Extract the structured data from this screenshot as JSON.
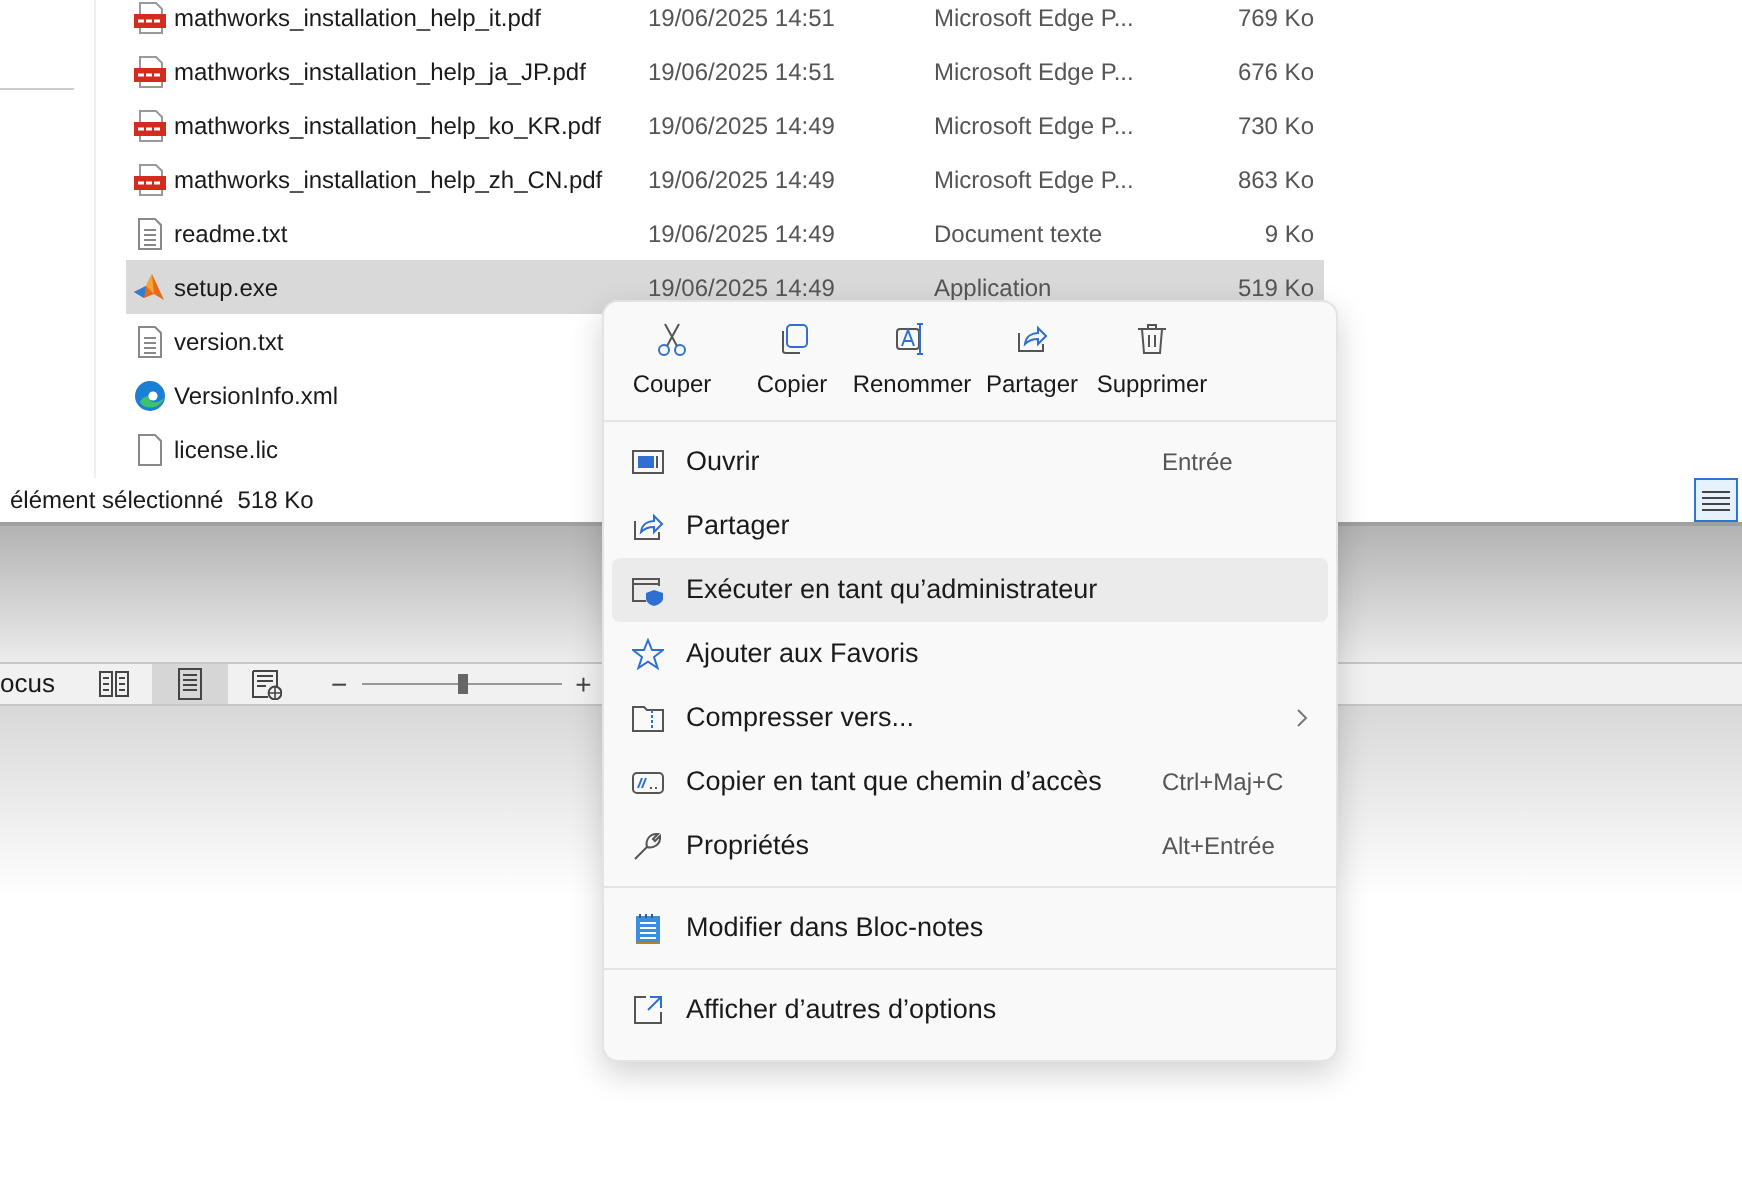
{
  "explorer": {
    "files": [
      {
        "name": "mathworks_installation_help_it.pdf",
        "kind": "pdf",
        "date": "19/06/2025 14:51",
        "type": "Microsoft Edge P...",
        "size": "769 Ko",
        "selected": false
      },
      {
        "name": "mathworks_installation_help_ja_JP.pdf",
        "kind": "pdf",
        "date": "19/06/2025 14:51",
        "type": "Microsoft Edge P...",
        "size": "676 Ko",
        "selected": false
      },
      {
        "name": "mathworks_installation_help_ko_KR.pdf",
        "kind": "pdf",
        "date": "19/06/2025 14:49",
        "type": "Microsoft Edge P...",
        "size": "730 Ko",
        "selected": false
      },
      {
        "name": "mathworks_installation_help_zh_CN.pdf",
        "kind": "pdf",
        "date": "19/06/2025 14:49",
        "type": "Microsoft Edge P...",
        "size": "863 Ko",
        "selected": false
      },
      {
        "name": "readme.txt",
        "kind": "text",
        "date": "19/06/2025 14:49",
        "type": "Document texte",
        "size": "9 Ko",
        "selected": false
      },
      {
        "name": "setup.exe",
        "kind": "app",
        "date": "19/06/2025 14:49",
        "type": "Application",
        "size": "519 Ko",
        "selected": true
      },
      {
        "name": "version.txt",
        "kind": "text",
        "selected": false
      },
      {
        "name": "VersionInfo.xml",
        "kind": "web",
        "selected": false
      },
      {
        "name": "license.lic",
        "kind": "file",
        "selected": false
      }
    ],
    "status_bar": {
      "selection": "élément sélectionné",
      "size": "518 Ko"
    }
  },
  "word_status_bar": {
    "focus_label": "ocus",
    "views": [
      {
        "selected": false
      },
      {
        "selected": true
      },
      {
        "selected": false
      }
    ],
    "zoom_out": "−",
    "zoom_in": "+",
    "zoom": {
      "level": 0.5
    }
  },
  "context_menu": {
    "toolbar": [
      {
        "label": "Couper"
      },
      {
        "label": "Copier"
      },
      {
        "label": "Renommer"
      },
      {
        "label": "Partager"
      },
      {
        "label": "Supprimer"
      }
    ],
    "sections": [
      [
        {
          "label": "Ouvrir",
          "shortcut": "Entrée",
          "highlighted": false,
          "submenu": false
        },
        {
          "label": "Partager",
          "highlighted": false,
          "submenu": false
        },
        {
          "label": "Exécuter en tant qu’administrateur",
          "highlighted": true,
          "submenu": false
        },
        {
          "label": "Ajouter aux Favoris",
          "highlighted": false,
          "submenu": false
        },
        {
          "label": "Compresser vers...",
          "highlighted": false,
          "submenu": true
        },
        {
          "label": "Copier en tant que chemin d’accès",
          "shortcut": "Ctrl+Maj+C",
          "highlighted": false,
          "submenu": false
        },
        {
          "label": "Propriétés",
          "shortcut": "Alt+Entrée",
          "highlighted": false,
          "submenu": false
        }
      ],
      [
        {
          "label": "Modifier dans Bloc-notes",
          "highlighted": false,
          "submenu": false
        }
      ],
      [
        {
          "label": "Afficher d’autres d’options",
          "highlighted": false,
          "submenu": false
        }
      ]
    ]
  }
}
